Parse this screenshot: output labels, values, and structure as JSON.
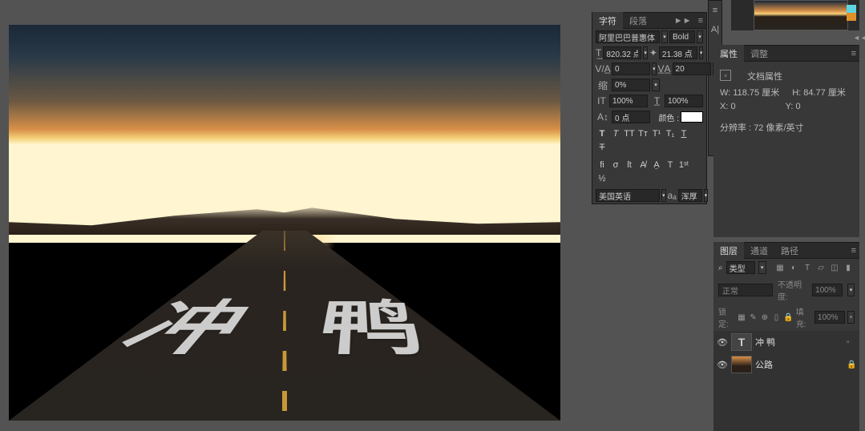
{
  "canvas": {
    "road_text": "冲 鸭"
  },
  "char_panel": {
    "tab1": "字符",
    "tab2": "段落",
    "collapse": "►►",
    "font_family": "阿里巴巴普惠体",
    "font_style": "Bold",
    "font_size": "820.32 点",
    "leading": "21.38 点",
    "kerning": "0",
    "tracking": "20",
    "scale_label": "缩",
    "scale": "0%",
    "vscale": "100%",
    "hscale": "100%",
    "baseline_label": "A↕",
    "baseline": "0 点",
    "color_label": "颜色 :",
    "language": "美国英语",
    "aa": "浑厚"
  },
  "strip": {
    "icon1": "≡",
    "icon2": "A|"
  },
  "nav": {
    "swatch1": "#5ed4e0",
    "swatch2": "#e09028"
  },
  "props": {
    "tab1": "属性",
    "tab2": "调整",
    "doc_label": "文档属性",
    "w_label": "W:",
    "w_val": "118.75 厘米",
    "h_label": "H:",
    "h_val": "84.77 厘米",
    "x_label": "X:",
    "x_val": "0",
    "y_label": "Y:",
    "y_val": "0",
    "res_label": "分辨率 :",
    "res_val": "72 像素/英寸"
  },
  "layers": {
    "tab1": "图层",
    "tab2": "通道",
    "tab3": "路径",
    "filter_label": "类型",
    "blend_mode": "正常",
    "opacity_label": "不透明度:",
    "opacity": "100%",
    "lock_label": "锁定:",
    "fill_label": "填充:",
    "fill": "100%",
    "layer1_name": "冲 鸭",
    "layer1_type": "T",
    "layer2_name": "公路"
  }
}
